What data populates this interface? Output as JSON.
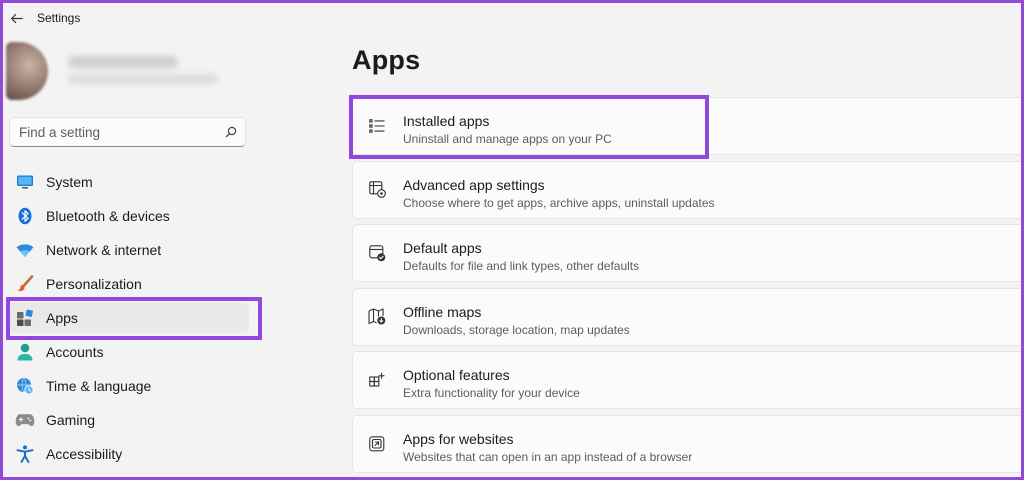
{
  "window": {
    "title": "Settings"
  },
  "search": {
    "placeholder": "Find a setting"
  },
  "sidebar": {
    "items": [
      {
        "label": "System",
        "icon": "monitor-icon"
      },
      {
        "label": "Bluetooth & devices",
        "icon": "bluetooth-icon"
      },
      {
        "label": "Network & internet",
        "icon": "wifi-icon"
      },
      {
        "label": "Personalization",
        "icon": "paintbrush-icon"
      },
      {
        "label": "Apps",
        "icon": "apps-icon",
        "selected": true
      },
      {
        "label": "Accounts",
        "icon": "person-icon"
      },
      {
        "label": "Time & language",
        "icon": "globe-clock-icon"
      },
      {
        "label": "Gaming",
        "icon": "gamepad-icon"
      },
      {
        "label": "Accessibility",
        "icon": "accessibility-icon"
      }
    ]
  },
  "main": {
    "title": "Apps",
    "cards": [
      {
        "title": "Installed apps",
        "description": "Uninstall and manage apps on your PC",
        "icon": "list-icon"
      },
      {
        "title": "Advanced app settings",
        "description": "Choose where to get apps, archive apps, uninstall updates",
        "icon": "app-settings-icon"
      },
      {
        "title": "Default apps",
        "description": "Defaults for file and link types, other defaults",
        "icon": "default-apps-icon"
      },
      {
        "title": "Offline maps",
        "description": "Downloads, storage location, map updates",
        "icon": "map-download-icon"
      },
      {
        "title": "Optional features",
        "description": "Extra functionality for your device",
        "icon": "add-grid-icon"
      },
      {
        "title": "Apps for websites",
        "description": "Websites that can open in an app instead of a browser",
        "icon": "open-in-app-icon"
      }
    ]
  },
  "colors": {
    "highlight": "#9248e0",
    "frame": "#8f4bd6",
    "background": "#f3f3f3",
    "card": "#fbfbfb"
  }
}
